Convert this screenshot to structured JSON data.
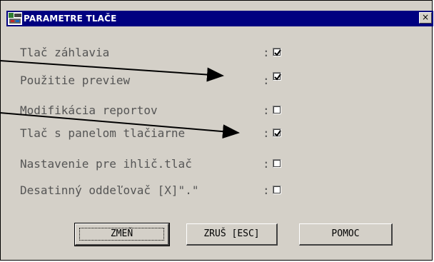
{
  "window": {
    "title": "PARAMETRE TLAČE",
    "close_glyph": "×"
  },
  "options": [
    {
      "label": "Tlač záhlavia",
      "sep": ":",
      "checked": true
    },
    {
      "label": "Použitie preview",
      "sep": ":",
      "checked": true
    },
    {
      "label": "Modifikácia reportov",
      "sep": ":",
      "checked": false
    },
    {
      "label": "Tlač s panelom tlačiarne",
      "sep": ":",
      "checked": true
    },
    {
      "label": "Nastavenie pre ihlič.tlač",
      "sep": ":",
      "checked": false
    },
    {
      "label": "Desatinný oddeľovač [X]\".\"",
      "sep": ":",
      "checked": false
    }
  ],
  "buttons": {
    "change": "ZMEŇ",
    "cancel": "ZRUŠ [ESC]",
    "help": "POMOC"
  },
  "colors": {
    "titlebar": "#000080",
    "window_bg": "#d4d0c8"
  }
}
